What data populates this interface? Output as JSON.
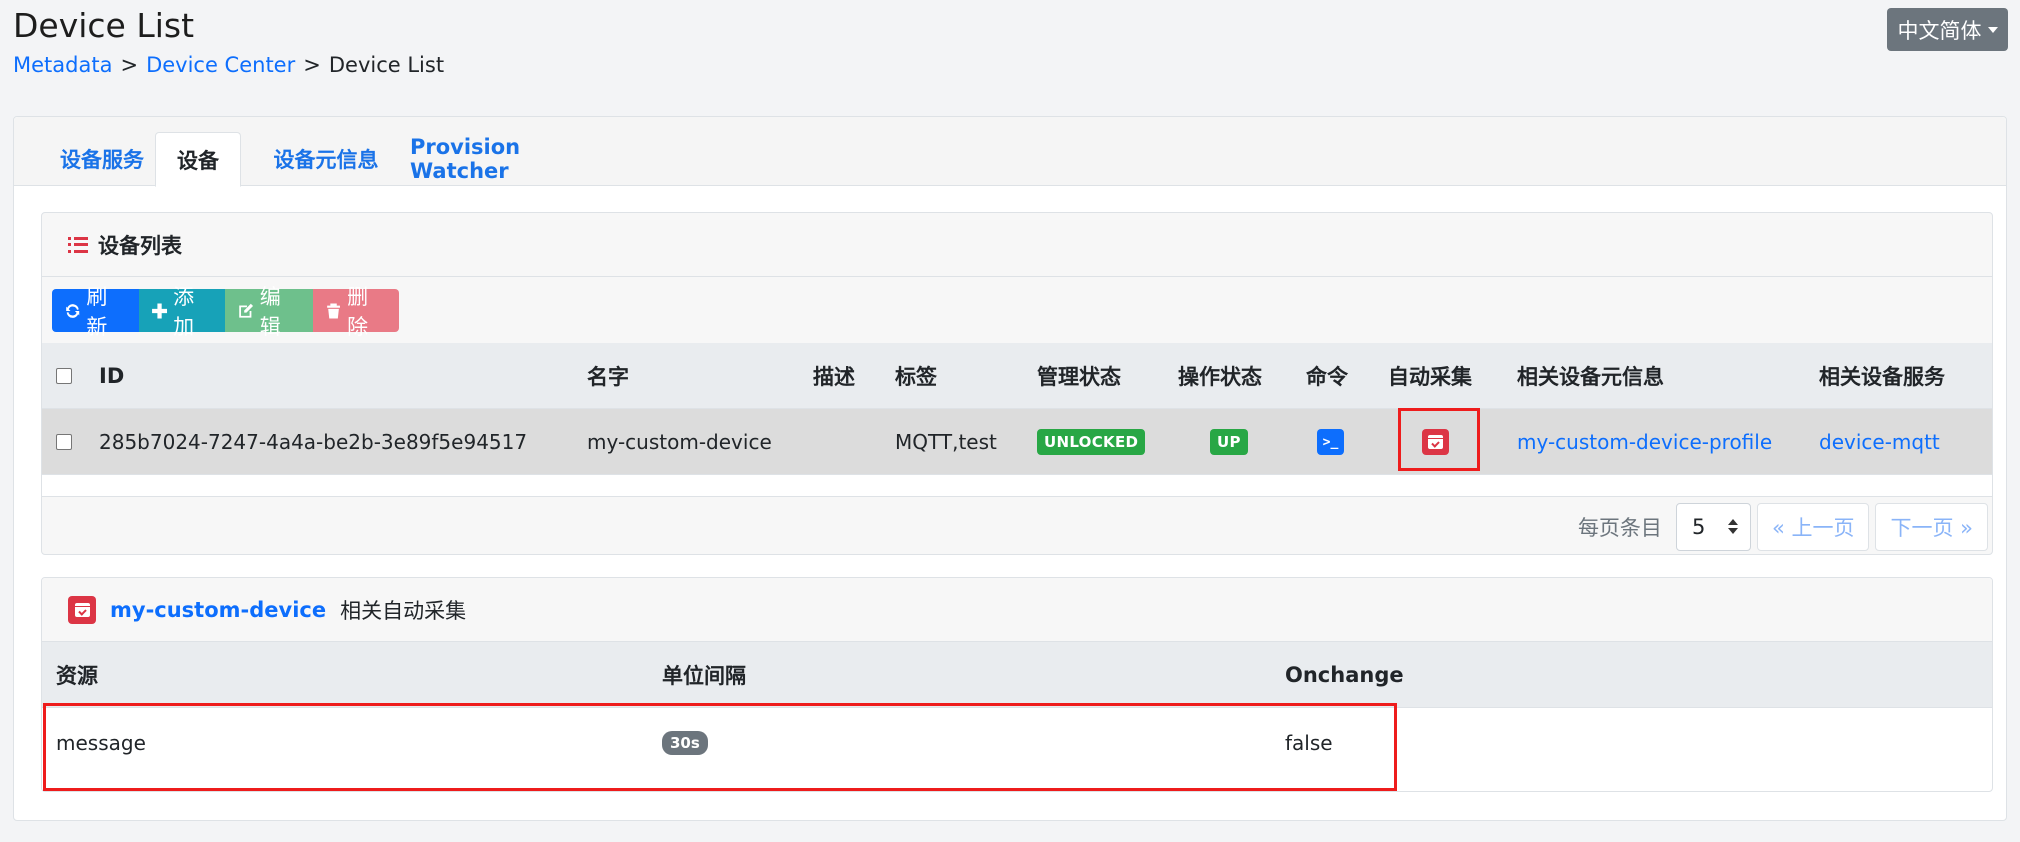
{
  "header": {
    "title": "Device List",
    "breadcrumb": [
      {
        "label": "Metadata"
      },
      {
        "label": "Device Center"
      },
      {
        "label": "Device List"
      }
    ],
    "breadcrumb_sep": ">",
    "language": "中文简体"
  },
  "tabs": [
    "设备服务",
    "设备",
    "设备元信息",
    "Provision Watcher"
  ],
  "active_tab": "设备",
  "device_list": {
    "title": "设备列表",
    "toolbar": {
      "refresh": "刷新",
      "add": "添加",
      "edit": "编辑",
      "delete": "删除"
    },
    "columns": [
      "ID",
      "名字",
      "描述",
      "标签",
      "管理状态",
      "操作状态",
      "命令",
      "自动采集",
      "相关设备元信息",
      "相关设备服务"
    ],
    "rows": [
      {
        "id": "285b7024-7247-4a4a-be2b-3e89f5e94517",
        "name": "my-custom-device",
        "description": "",
        "labels": "MQTT,test",
        "admin_state": "UNLOCKED",
        "operating_state": "UP",
        "command_icon": "terminal-icon",
        "autoevent_icon": "calendar-check-icon",
        "profile": "my-custom-device-profile",
        "service": "device-mqtt"
      }
    ],
    "pagination": {
      "per_page_label": "每页条目",
      "per_page": "5",
      "prev": "« 上一页",
      "next": "下一页 »"
    }
  },
  "autoevents": {
    "device": "my-custom-device",
    "title_suffix": "相关自动采集",
    "columns": [
      "资源",
      "单位间隔",
      "Onchange"
    ],
    "rows": [
      {
        "resource": "message",
        "interval": "30s",
        "onchange": "false"
      }
    ]
  },
  "colors": {
    "primary": "#0d6efd",
    "success": "#28a745",
    "danger": "#dc3545",
    "info": "#17a2b8",
    "highlight": "#ee1c1c"
  }
}
